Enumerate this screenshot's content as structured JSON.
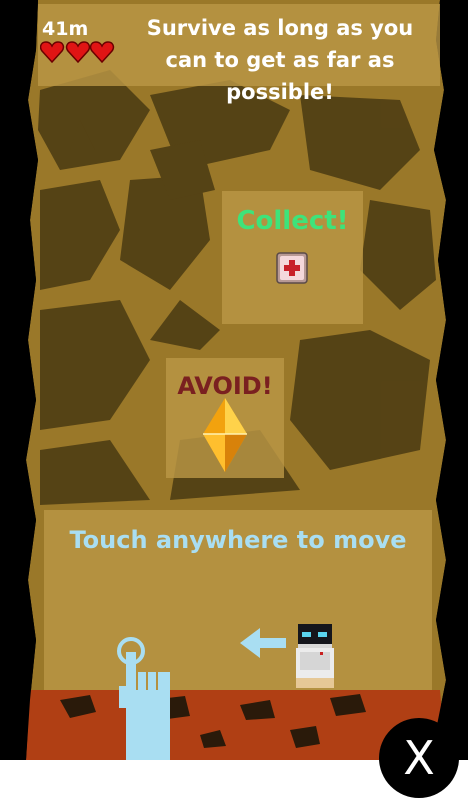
{
  "hud": {
    "distance": "41m",
    "lives": 3,
    "intro_text": "Survive as long as you can to get as far as possible!"
  },
  "tutorial": {
    "collect_label": "Collect!",
    "collect_item_icon": "medkit-icon",
    "avoid_label": "AVOID!",
    "avoid_item_icon": "crystal-hazard-icon",
    "touch_label": "Touch anywhere to move",
    "hand_icon": "pointing-hand-icon",
    "arrow_icon": "left-arrow-icon",
    "player_icon": "robot-player-icon"
  },
  "close": {
    "label": "X"
  },
  "colors": {
    "cave_dirt": "#9c7a2c",
    "cave_rock": "#473814",
    "collect_text": "#3ee37a",
    "avoid_text": "#7a2020",
    "touch_text": "#a9def2",
    "lava": "#b03f14"
  }
}
